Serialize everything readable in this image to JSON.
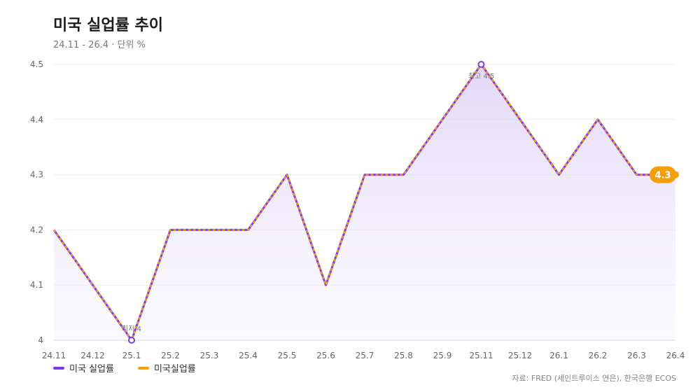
{
  "header": {
    "title": "미국 실업률 추이",
    "subtitle": "24.11 - 26.4 · 단위 %"
  },
  "source": "자료: FRED (세인트루이스 연은), 한국은행 ECOS",
  "colors": {
    "purple": "#7c3aed",
    "orange": "#f59e0b",
    "fill": "#ede7fb",
    "grid": "#ececec"
  },
  "chart_data": {
    "type": "line",
    "title": "미국 실업률 추이",
    "subtitle": "24.11 - 26.4 · 단위 %",
    "categories": [
      "24.11",
      "24.12",
      "25.1",
      "25.2",
      "25.3",
      "25.4",
      "25.5",
      "25.6",
      "25.7",
      "25.8",
      "25.9",
      "25.11",
      "25.12",
      "26.1",
      "26.2",
      "26.3",
      "26.4"
    ],
    "series": [
      {
        "name": "미국 실업률",
        "color": "#7c3aed",
        "values": [
          4.2,
          4.1,
          4.0,
          4.2,
          4.2,
          4.2,
          4.3,
          4.1,
          4.3,
          4.3,
          4.4,
          4.5,
          4.4,
          4.3,
          4.4,
          4.3,
          4.3
        ]
      },
      {
        "name": "미국실업률",
        "color": "#f59e0b",
        "values": [
          4.2,
          4.1,
          4.0,
          4.2,
          4.2,
          4.2,
          4.3,
          4.1,
          4.3,
          4.3,
          4.4,
          4.5,
          4.4,
          4.3,
          4.4,
          4.3,
          4.3
        ]
      }
    ],
    "yticks": [
      "4",
      "4.1",
      "4.2",
      "4.3",
      "4.4",
      "4.5"
    ],
    "ylim": [
      4.0,
      4.5
    ],
    "grid": true,
    "legend": "bottom-left",
    "annotations": [
      {
        "label": "최고 4.5",
        "index": 11,
        "value": 4.5
      },
      {
        "label": "최저 4",
        "index": 2,
        "value": 4.0
      }
    ],
    "last_value_label": "4.3"
  }
}
